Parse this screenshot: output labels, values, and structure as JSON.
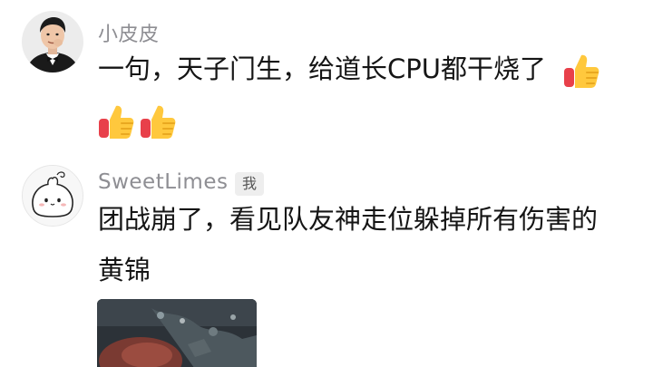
{
  "comments": [
    {
      "username": "小皮皮",
      "text": "一句，天子门生，给道长CPU都干烧了",
      "reaction_icons": [
        "thumbs-up-emoji",
        "thumbs-up-emoji",
        "thumbs-up-emoji"
      ]
    },
    {
      "username": "SweetLimes",
      "badge": "我",
      "text_line_1": "团战崩了，看见队友神走位躲掉所有伤害的",
      "text_line_2": "黄锦",
      "has_image": true
    }
  ],
  "colors": {
    "username": "#8e8e93",
    "body_text": "#151515",
    "badge_bg": "#eeeeee",
    "emoji_yellow": "#ffc83d",
    "emoji_red": "#e8404a"
  }
}
